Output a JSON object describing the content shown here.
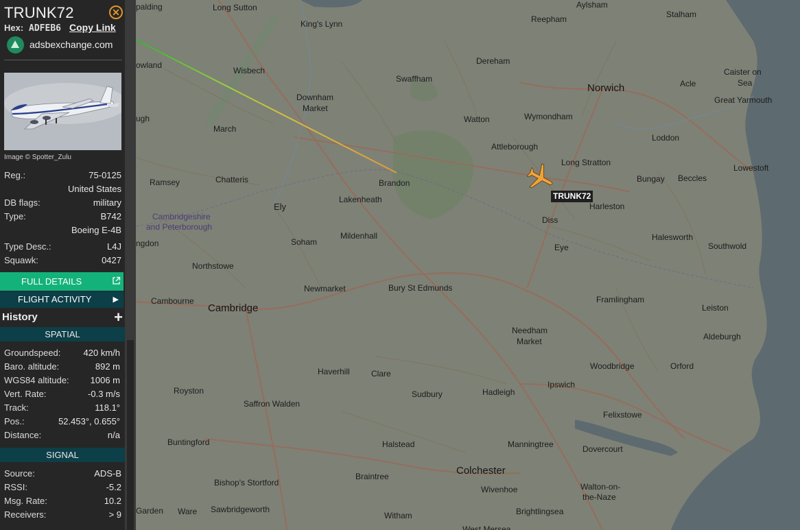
{
  "aircraft": {
    "callsign": "TRUNK72",
    "hex_label": "Hex:",
    "hex": "ADFEB6",
    "copy_link": "Copy Link",
    "site": "adsbexchange.com",
    "photo_credit": "Image © Spotter_Zulu"
  },
  "details": {
    "reg_label": "Reg.:",
    "reg": "75-0125",
    "country": "United States",
    "db_flags_label": "DB flags:",
    "db_flags": "military",
    "type_label": "Type:",
    "type": "B742",
    "type_name": "Boeing E-4B",
    "type_desc_label": "Type Desc.:",
    "type_desc": "L4J",
    "squawk_label": "Squawk:",
    "squawk": "0427"
  },
  "buttons": {
    "full_details": "FULL DETAILS",
    "flight_activity": "FLIGHT ACTIVITY",
    "history": "History"
  },
  "spatial": {
    "header": "SPATIAL",
    "groundspeed_label": "Groundspeed:",
    "groundspeed": "420 km/h",
    "baro_label": "Baro. altitude:",
    "baro": "892 m",
    "wgs_label": "WGS84 altitude:",
    "wgs": "1006 m",
    "vrate_label": "Vert. Rate:",
    "vrate": "-0.3 m/s",
    "track_label": "Track:",
    "track": "118.1°",
    "pos_label": "Pos.:",
    "pos": "52.453°, 0.655°",
    "distance_label": "Distance:",
    "distance": "n/a"
  },
  "signal": {
    "header": "SIGNAL",
    "source_label": "Source:",
    "source": "ADS-B",
    "rssi_label": "RSSI:",
    "rssi": "-5.2",
    "msg_label": "Msg. Rate:",
    "msg": "10.2",
    "receivers_label": "Receivers:",
    "receivers": "> 9"
  },
  "map": {
    "towns": [
      "Long Sutton",
      "King's Lynn",
      "Aylsham",
      "Stalham",
      "Reepham",
      "Swaffham",
      "Dereham",
      "Wisbech",
      "Norwich",
      "Acle",
      "Caister on",
      "Sea",
      "Great Yarmouth",
      "Downham",
      "Market",
      "Watton",
      "Wymondham",
      "March",
      "Attleborough",
      "Loddon",
      "Long Stratton",
      "Lowestoft",
      "Ramsey",
      "Chatteris",
      "Brandon",
      "Bungay",
      "Beccles",
      "Lakenheath",
      "Cambridgeshire",
      "and Peterborough",
      "Ely",
      "Harleston",
      "Diss",
      "Halesworth",
      "Mildenhall",
      "Soham",
      "Eye",
      "Southwold",
      "Northstowe",
      "Newmarket",
      "Bury St Edmunds",
      "Framlingham",
      "Leiston",
      "Cambourne",
      "Cambridge",
      "Needham",
      "Market",
      "Aldeburgh",
      "Woodbridge",
      "Orford",
      "Haverhill",
      "Clare",
      "Royston",
      "Sudbury",
      "Hadleigh",
      "Ipswich",
      "Saffron Walden",
      "Felixstowe",
      "Buntingford",
      "Halstead",
      "Manningtree",
      "Dovercourt",
      "Colchester",
      "Braintree",
      "Bishop's Stortford",
      "Walton-on-",
      "the-Naze",
      "Wivenhoe",
      "Brightlingsea",
      "Sawbridgeworth",
      "Witham",
      "Garden",
      "Ware",
      "West Mersea",
      "palding",
      "owland",
      "ugh",
      "ngdon"
    ]
  }
}
